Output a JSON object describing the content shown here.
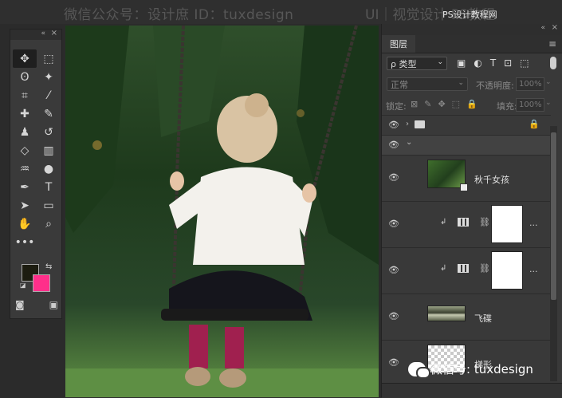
{
  "watermark": {
    "top_left": "微信公众号：设计庶  ID：tuxdesign",
    "top_right": "UI｜视觉设计   PS教程",
    "site": "PS设计教程网",
    "wechat": "微信号: tuxdesign"
  },
  "tools_panel": {
    "collapse": "«",
    "close": "×",
    "tools": [
      {
        "name": "move-tool",
        "glyph": "✥",
        "active": true
      },
      {
        "name": "marquee-tool",
        "glyph": "⬚"
      },
      {
        "name": "lasso-tool",
        "glyph": "ʘ"
      },
      {
        "name": "magic-wand-tool",
        "glyph": "✦"
      },
      {
        "name": "crop-tool",
        "glyph": "⌗"
      },
      {
        "name": "eyedropper-tool",
        "glyph": "⁄"
      },
      {
        "name": "healing-tool",
        "glyph": "✚"
      },
      {
        "name": "brush-tool",
        "glyph": "✎"
      },
      {
        "name": "stamp-tool",
        "glyph": "♟"
      },
      {
        "name": "history-brush-tool",
        "glyph": "↺"
      },
      {
        "name": "eraser-tool",
        "glyph": "◇"
      },
      {
        "name": "gradient-tool",
        "glyph": "▥"
      },
      {
        "name": "blur-tool",
        "glyph": "♒"
      },
      {
        "name": "dodge-tool",
        "glyph": "●"
      },
      {
        "name": "pen-tool",
        "glyph": "✒"
      },
      {
        "name": "type-tool",
        "glyph": "T"
      },
      {
        "name": "path-selection-tool",
        "glyph": "➤"
      },
      {
        "name": "shape-tool",
        "glyph": "▭"
      },
      {
        "name": "hand-tool",
        "glyph": "✋"
      },
      {
        "name": "zoom-tool",
        "glyph": "⌕"
      },
      {
        "name": "more-tools",
        "glyph": "•••"
      }
    ],
    "foreground_color": "#1c1c10",
    "background_color": "#ff2f8a",
    "quick_mask": "◙",
    "screen_mode": "▣"
  },
  "layers_panel": {
    "collapse": "«",
    "close": "×",
    "tab": "图层",
    "menu": "≡",
    "filter": {
      "value": "ρ 类型",
      "chev": "⌄"
    },
    "filter_icons": [
      "▣",
      "◐",
      "T",
      "⊡",
      "⬚"
    ],
    "blend": {
      "value": "正常",
      "chev": "⌄"
    },
    "opacity": {
      "label": "不透明度:",
      "value": "100%"
    },
    "lock": {
      "label": "锁定:",
      "icons": [
        "⊠",
        "✎",
        "✥",
        "⬚",
        "🔒"
      ]
    },
    "fill": {
      "label": "填充:",
      "value": "100%"
    },
    "groups": [
      {
        "eye": "👁",
        "arrow": "›",
        "locked": true,
        "lock_glyph": "🔒"
      },
      {
        "eye": "👁",
        "arrow": "⌄"
      }
    ],
    "layers": [
      {
        "name": "秋千女孩",
        "kind": "photo",
        "eye": "👁"
      },
      {
        "name": "",
        "kind": "adjustment",
        "eye": "👁",
        "clip": "↲",
        "chain": "⛓",
        "more": "..."
      },
      {
        "name": "",
        "kind": "adjustment",
        "eye": "👁",
        "clip": "↲",
        "chain": "⛓",
        "more": "..."
      },
      {
        "name": "飞碟",
        "kind": "ufo",
        "eye": "👁"
      },
      {
        "name": "梯形",
        "kind": "checker",
        "eye": "👁"
      }
    ]
  }
}
